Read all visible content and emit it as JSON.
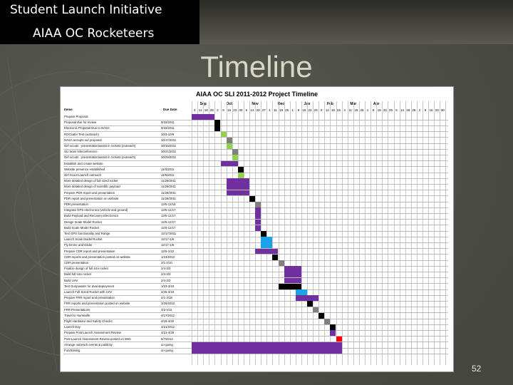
{
  "header": {
    "title": "Student Launch Initiative",
    "subtitle": "AIAA OC Rocketeers"
  },
  "slide": {
    "title": "Timeline",
    "page_number": "52"
  },
  "timeline": {
    "title": "AIAA OC SLI 2011-2012 Project Timeline",
    "col_items": "Items",
    "col_due": "Due Date",
    "months": [
      "Sep",
      "Oct",
      "Nov",
      "Dec",
      "Jan",
      "Feb",
      "Mar",
      "Apr"
    ],
    "days": [
      "4",
      "11",
      "18",
      "25",
      "2",
      "9",
      "16",
      "23",
      "30",
      "6",
      "13",
      "20",
      "27",
      "4",
      "11",
      "18",
      "25",
      "1",
      "8",
      "15",
      "22",
      "29",
      "5",
      "12",
      "19",
      "26",
      "4",
      "11",
      "18",
      "25",
      "1",
      "8",
      "15",
      "22",
      "29",
      "5",
      "12",
      "19",
      "26",
      "2",
      "9",
      "16",
      "23",
      "30"
    ],
    "rows": [
      {
        "name": "Prepare Proposal",
        "due": "",
        "color": "#7030a0",
        "start": 0,
        "span": 4
      },
      {
        "name": "Proposal due for review",
        "due": "9/15/2011",
        "color": "#000000",
        "start": 4,
        "span": 1
      },
      {
        "name": "Electronic Proposal Due to NASA",
        "due": "9/15/2011",
        "color": "#000000",
        "start": 4,
        "span": 1
      },
      {
        "name": "ROCsafer Test (outreach)",
        "due": "10/3-10/9",
        "color": "#92d050",
        "start": 5,
        "span": 1
      },
      {
        "name": "NASA accepts our proposal",
        "due": "10/17/2011",
        "color": "#808080",
        "start": 6,
        "span": 1
      },
      {
        "name": "Girl scouts - presentation/assist in rockets (outreach)",
        "due": "10/15/2011",
        "color": "#92d050",
        "start": 6,
        "span": 1
      },
      {
        "name": "SLI team teleconference",
        "due": "10/21/2011",
        "color": "#808080",
        "start": 7,
        "span": 1
      },
      {
        "name": "Girl scouts - presentation/assist in rockets (outreach)",
        "due": "10/29/2011",
        "color": "#92d050",
        "start": 7,
        "span": 1
      },
      {
        "name": "Establish and create website",
        "due": "",
        "color": "#7030a0",
        "start": 5,
        "span": 3
      },
      {
        "name": "Website presence established",
        "due": "11/3/2011",
        "color": "#000000",
        "start": 8,
        "span": 1
      },
      {
        "name": "Girl Scout Launch outreach",
        "due": "11/5/2011",
        "color": "#92d050",
        "start": 8,
        "span": 1
      },
      {
        "name": "More detailed design of full sized rocket",
        "due": "11/28/2011",
        "color": "#7030a0",
        "start": 6,
        "span": 4
      },
      {
        "name": "More detailed design of scientific payload",
        "due": "11/28/2011",
        "color": "#7030a0",
        "start": 6,
        "span": 4
      },
      {
        "name": "Prepare PDR report and presentation",
        "due": "11/28/2011",
        "color": "#7030a0",
        "start": 6,
        "span": 4
      },
      {
        "name": "PDR report and presentation on website",
        "due": "11/28/2011",
        "color": "#000000",
        "start": 10,
        "span": 1
      },
      {
        "name": "PDR presentation",
        "due": "12/5-12/16",
        "color": "#808080",
        "start": 11,
        "span": 1
      },
      {
        "name": "Integrate GPS electronics (vehicle and ground)",
        "due": "12/5-12/17",
        "color": "#7030a0",
        "start": 11,
        "span": 1
      },
      {
        "name": "Build Payload and Recovery Electronics",
        "due": "12/5-12/17",
        "color": "#7030a0",
        "start": 11,
        "span": 1
      },
      {
        "name": "Design Scale Model Rocket",
        "due": "12/5-12/17",
        "color": "#7030a0",
        "start": 11,
        "span": 1
      },
      {
        "name": "Build Scale Model Rocket",
        "due": "12/5-12/17",
        "color": "#7030a0",
        "start": 11,
        "span": 1
      },
      {
        "name": "Test GPS functionality and Range",
        "due": "12/17/2011",
        "color": "#000000",
        "start": 12,
        "span": 1
      },
      {
        "name": "Launch Scale Model Rocket",
        "due": "12/17-1/6",
        "color": "#1aa3e8",
        "start": 12,
        "span": 2
      },
      {
        "name": "Fly Drone and Glider",
        "due": "12/17-1/6",
        "color": "#1aa3e8",
        "start": 12,
        "span": 2
      },
      {
        "name": "Prepare CDR report and presentation",
        "due": "12/5-1/22",
        "color": "#7030a0",
        "start": 11,
        "span": 4
      },
      {
        "name": "CDR reports and presentation posted on website",
        "due": "1/23/2012",
        "color": "#000000",
        "start": 14,
        "span": 1
      },
      {
        "name": "CDR presentation",
        "due": "2/1-2/10",
        "color": "#808080",
        "start": 15,
        "span": 1
      },
      {
        "name": "Finalize design of full size rocket",
        "due": "2/4-3/3",
        "color": "#7030a0",
        "start": 16,
        "span": 3
      },
      {
        "name": "Build full size rocket",
        "due": "2/4-3/3",
        "color": "#7030a0",
        "start": 16,
        "span": 3
      },
      {
        "name": "Build UAV",
        "due": "2/4-3/3",
        "color": "#7030a0",
        "start": 16,
        "span": 3
      },
      {
        "name": "Test Gunpowder for dual deployment",
        "due": "1/23-3/10",
        "color": "#000000",
        "start": 15,
        "span": 4
      },
      {
        "name": "Launch Full Sized Rocket with UAV",
        "due": "2/25-3/10",
        "color": "#1aa3e8",
        "start": 18,
        "span": 2
      },
      {
        "name": "Prepare FRR report and presentation",
        "due": "2/1-3/18",
        "color": "#7030a0",
        "start": 18,
        "span": 4
      },
      {
        "name": "FRR reports and presentation posted on website",
        "due": "3/26/2012",
        "color": "#000000",
        "start": 20,
        "span": 1
      },
      {
        "name": "FRR Presentations",
        "due": "4/2-4/11",
        "color": "#808080",
        "start": 21,
        "span": 1
      },
      {
        "name": "Travel to Huntsville",
        "due": "4/17/2012",
        "color": "#000000",
        "start": 22,
        "span": 1
      },
      {
        "name": "Flight Hardware and Safety Checks",
        "due": "4/18-4/20",
        "color": "#808080",
        "start": 23,
        "span": 1
      },
      {
        "name": "Launch Day",
        "due": "4/21/2012",
        "color": "#000000",
        "start": 24,
        "span": 1
      },
      {
        "name": "Prepare Post Launch Assessment Review",
        "due": "4/21-4/28",
        "color": "#7030a0",
        "start": 24,
        "span": 1
      },
      {
        "name": "Post-Launch Assessment Review posted on Web",
        "due": "5/7/2012",
        "color": "#ff0000",
        "start": 25,
        "span": 1
      },
      {
        "name": "Arrange outreach events & publicity",
        "due": "on-going",
        "color": "#7030a0",
        "start": 0,
        "span": 26
      },
      {
        "name": "Fundraising",
        "due": "on-going",
        "color": "#7030a0",
        "start": 0,
        "span": 26
      }
    ]
  }
}
